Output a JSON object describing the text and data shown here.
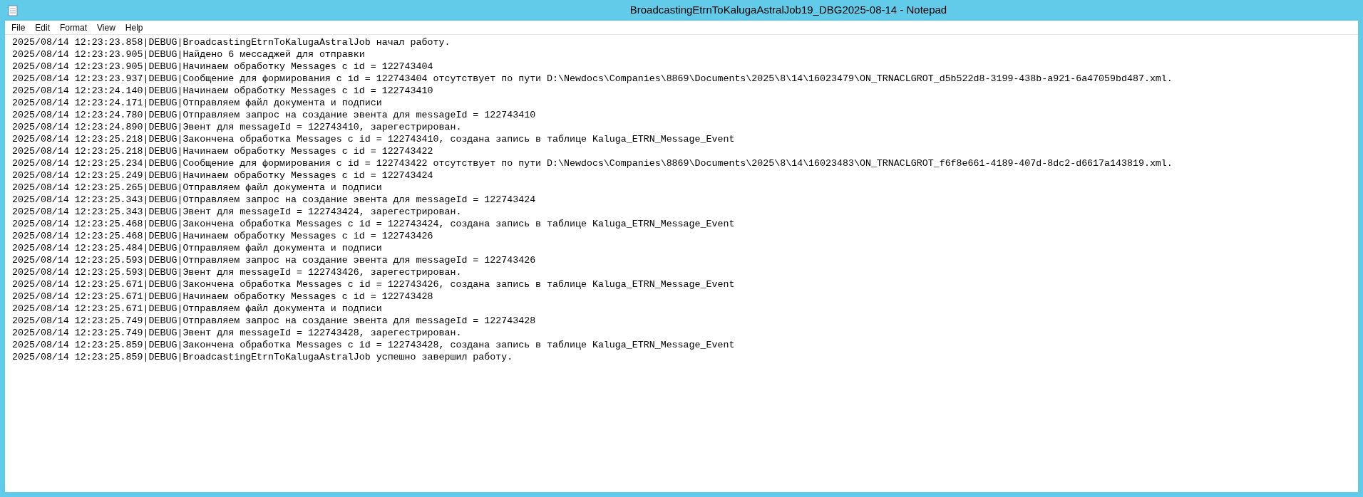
{
  "window": {
    "title": "BroadcastingEtrnToKalugaAstralJob19_DBG2025-08-14 - Notepad"
  },
  "menu": [
    "File",
    "Edit",
    "Format",
    "View",
    "Help"
  ],
  "editor": {
    "lines": [
      "2025/08/14 12:23:23.858|DEBUG|BroadcastingEtrnToKalugaAstralJob начал работу.",
      "2025/08/14 12:23:23.905|DEBUG|Найдено 6 мессаджей для отправки",
      "2025/08/14 12:23:23.905|DEBUG|Начинаем обработку Messages с id = 122743404",
      "2025/08/14 12:23:23.937|DEBUG|Сообщение для формирования с id = 122743404 отсутствует по пути D:\\Newdocs\\Companies\\8869\\Documents\\2025\\8\\14\\16023479\\ON_TRNACLGROT_d5b522d8-3199-438b-a921-6a47059bd487.xml.",
      "2025/08/14 12:23:24.140|DEBUG|Начинаем обработку Messages с id = 122743410",
      "2025/08/14 12:23:24.171|DEBUG|Отправляем файл документа и подписи",
      "2025/08/14 12:23:24.780|DEBUG|Отправляем запрос на создание эвента для messageId = 122743410",
      "2025/08/14 12:23:24.890|DEBUG|Эвент для messageId = 122743410, зарегестрирован.",
      "2025/08/14 12:23:25.218|DEBUG|Закончена обработка Messages с id = 122743410, создана запись в таблице Kaluga_ETRN_Message_Event",
      "2025/08/14 12:23:25.218|DEBUG|Начинаем обработку Messages с id = 122743422",
      "2025/08/14 12:23:25.234|DEBUG|Сообщение для формирования с id = 122743422 отсутствует по пути D:\\Newdocs\\Companies\\8869\\Documents\\2025\\8\\14\\16023483\\ON_TRNACLGROT_f6f8e661-4189-407d-8dc2-d6617a143819.xml.",
      "2025/08/14 12:23:25.249|DEBUG|Начинаем обработку Messages с id = 122743424",
      "2025/08/14 12:23:25.265|DEBUG|Отправляем файл документа и подписи",
      "2025/08/14 12:23:25.343|DEBUG|Отправляем запрос на создание эвента для messageId = 122743424",
      "2025/08/14 12:23:25.343|DEBUG|Эвент для messageId = 122743424, зарегестрирован.",
      "2025/08/14 12:23:25.468|DEBUG|Закончена обработка Messages с id = 122743424, создана запись в таблице Kaluga_ETRN_Message_Event",
      "2025/08/14 12:23:25.468|DEBUG|Начинаем обработку Messages с id = 122743426",
      "2025/08/14 12:23:25.484|DEBUG|Отправляем файл документа и подписи",
      "2025/08/14 12:23:25.593|DEBUG|Отправляем запрос на создание эвента для messageId = 122743426",
      "2025/08/14 12:23:25.593|DEBUG|Эвент для messageId = 122743426, зарегестрирован.",
      "2025/08/14 12:23:25.671|DEBUG|Закончена обработка Messages с id = 122743426, создана запись в таблице Kaluga_ETRN_Message_Event",
      "2025/08/14 12:23:25.671|DEBUG|Начинаем обработку Messages с id = 122743428",
      "2025/08/14 12:23:25.671|DEBUG|Отправляем файл документа и подписи",
      "2025/08/14 12:23:25.749|DEBUG|Отправляем запрос на создание эвента для messageId = 122743428",
      "2025/08/14 12:23:25.749|DEBUG|Эвент для messageId = 122743428, зарегестрирован.",
      "2025/08/14 12:23:25.859|DEBUG|Закончена обработка Messages с id = 122743428, создана запись в таблице Kaluga_ETRN_Message_Event",
      "2025/08/14 12:23:25.859|DEBUG|BroadcastingEtrnToKalugaAstralJob успешно завершил работу."
    ]
  }
}
